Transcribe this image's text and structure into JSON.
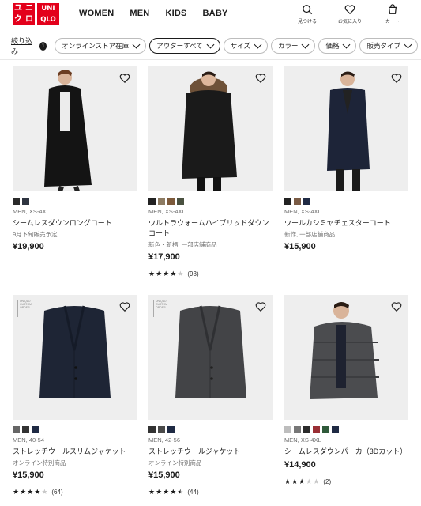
{
  "brand": {
    "logo_top": [
      "ユ",
      "ニ",
      "ク",
      "ロ"
    ],
    "logo_bottom": [
      "UNI",
      "QLO"
    ],
    "color": "#e3001b"
  },
  "nav": [
    "WOMEN",
    "MEN",
    "KIDS",
    "BABY"
  ],
  "utility": {
    "search": "見つける",
    "favorites": "お気に入り",
    "cart": "カート"
  },
  "filters": {
    "narrow_label": "絞り込み",
    "count": "1",
    "chips": [
      "オンラインストア在庫",
      "アウターすべて",
      "サイズ",
      "カラー",
      "価格",
      "販売タイプ"
    ],
    "active_chip": "アウターすべて"
  },
  "products": [
    {
      "name": "シームレスダウンロングコート",
      "meta": "MEN, XS-4XL",
      "note": "9月下旬販売予定",
      "price": "¥19,900",
      "swatches": [
        "#2b2b2b",
        "#2e3440"
      ],
      "rating": null,
      "count": null
    },
    {
      "name": "ウルトラウォームハイブリッドダウンコート",
      "meta": "MEN, XS-4XL",
      "note": "新色・新柄, 一部店舗商品",
      "price": "¥17,900",
      "swatches": [
        "#222222",
        "#8d7b62",
        "#7d5a3b",
        "#4a5140"
      ],
      "rating": 4,
      "count": "(93)"
    },
    {
      "name": "ウールカシミヤチェスターコート",
      "meta": "MEN, XS-4XL",
      "note": "新作, 一部店舗商品",
      "price": "¥15,900",
      "swatches": [
        "#222222",
        "#7a5b45",
        "#1f2a44"
      ],
      "rating": null,
      "count": null
    },
    {
      "name": "ストレッチウールスリムジャケット",
      "meta": "MEN, 40-54",
      "note": "オンライン特別商品",
      "price": "¥15,900",
      "swatches": [
        "#666666",
        "#333333",
        "#1f2a44"
      ],
      "rating": 4,
      "count": "(64)"
    },
    {
      "name": "ストレッチウールジャケット",
      "meta": "MEN, 42-56",
      "note": "オンライン特別商品",
      "price": "¥15,900",
      "swatches": [
        "#333333",
        "#4a4a4a",
        "#1f2a44"
      ],
      "rating": 4.5,
      "count": "(44)"
    },
    {
      "name": "シームレスダウンパーカ（3Dカット）",
      "meta": "MEN, XS-4XL",
      "note": "",
      "price": "¥14,900",
      "swatches": [
        "#bdbdbd",
        "#777777",
        "#2b2b2b",
        "#9a2f35",
        "#2f5a3a",
        "#1f2a44"
      ],
      "rating": 3,
      "count": "(2)"
    }
  ],
  "badge_text": "UNIQLO CUSTOM ORDER"
}
